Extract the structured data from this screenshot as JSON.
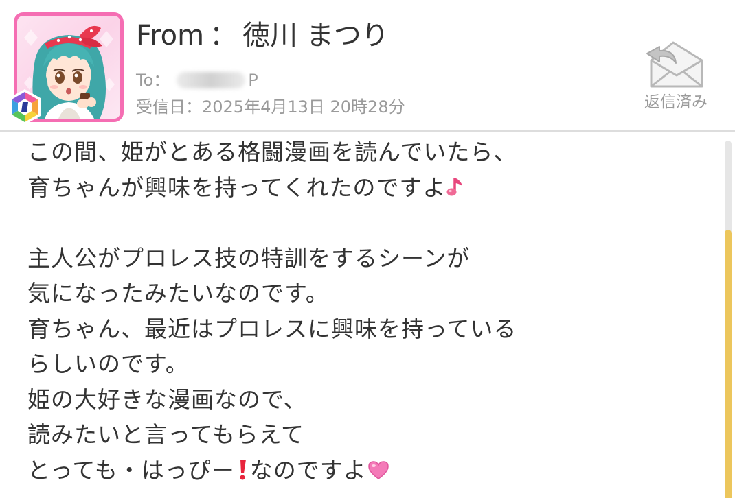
{
  "header": {
    "from_label": "From",
    "from_separator": "：",
    "sender_name": "徳川 まつり",
    "to_label": "To：",
    "to_suffix": "P",
    "received_text": "受信日：2025年4月13日 20時28分",
    "reply_status": "返信済み"
  },
  "message": {
    "lines": [
      "この間、姫がとある格闘漫画を読んでいたら、",
      "育ちゃんが興味を持ってくれたのですよ",
      "",
      "主人公がプロレス技の特訓をするシーンが",
      "気になったみたいなのです。",
      "育ちゃん、最近はプロレスに興味を持っている",
      "らしいのです。",
      "姫の大好きな漫画なので、",
      "読みたいと言ってもらえて",
      "とっても・はっぴー",
      "なのですよ"
    ]
  },
  "icons": {
    "avatar": "character-portrait",
    "badge": "idol-type-badge-icon",
    "reply": "envelope-reply-icon",
    "music_note": "music-note-icon",
    "exclamation": "exclamation-icon",
    "heart": "heart-icon"
  },
  "colors": {
    "accent_pink": "#f56eb3",
    "scrollbar_thumb": "#ecc65c",
    "muted_text": "#9a9a9a",
    "body_text": "#333333"
  }
}
